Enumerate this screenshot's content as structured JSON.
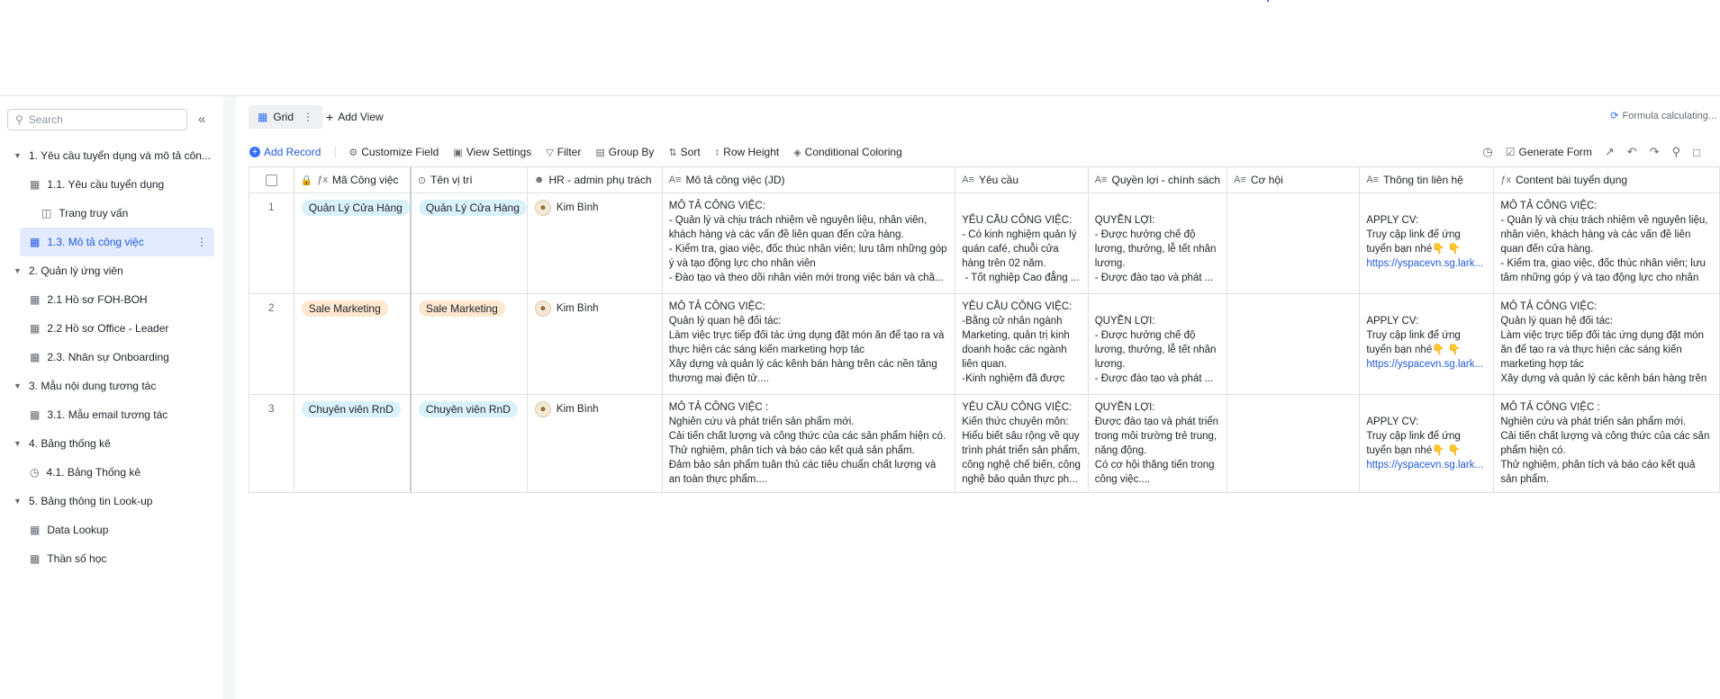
{
  "sidebar": {
    "search_placeholder": "Search",
    "items": [
      {
        "label": "1. Yêu cầu tuyển dụng và mô tả côn...",
        "level": 1
      },
      {
        "label": "1.1. Yêu cầu tuyển dụng",
        "level": 2,
        "icon": "table-icon"
      },
      {
        "label": "Trang truy vấn",
        "level": 3,
        "icon": "query-icon"
      },
      {
        "label": "1.3. Mô tả công việc",
        "level": 2,
        "icon": "table-icon",
        "selected": true
      },
      {
        "label": "2. Quản lý ứng viên",
        "level": 1
      },
      {
        "label": "2.1 Hồ sơ FOH-BOH",
        "level": 2,
        "icon": "table-icon"
      },
      {
        "label": "2.2 Hồ sơ Office - Leader",
        "level": 2,
        "icon": "table-icon"
      },
      {
        "label": "2.3. Nhân sự Onboarding",
        "level": 2,
        "icon": "table-icon"
      },
      {
        "label": "3. Mẫu nội dung tương tác",
        "level": 1
      },
      {
        "label": "3.1. Mẫu email tương tác",
        "level": 2,
        "icon": "table-icon"
      },
      {
        "label": "4. Bảng thống kê",
        "level": 1
      },
      {
        "label": "4.1. Bảng Thống kê",
        "level": 2,
        "icon": "dashboard-icon"
      },
      {
        "label": "5. Bảng thông tin Look-up",
        "level": 1
      },
      {
        "label": "Data Lookup",
        "level": 2,
        "icon": "table-icon"
      },
      {
        "label": "Thần số học",
        "level": 2,
        "icon": "table-icon"
      }
    ]
  },
  "tabs": {
    "grid": "Grid",
    "add_view": "Add View"
  },
  "status": "Formula calculating...",
  "toolbar": {
    "add_record": "Add Record",
    "customize_field": "Customize Field",
    "view_settings": "View Settings",
    "filter": "Filter",
    "group_by": "Group By",
    "sort": "Sort",
    "row_height": "Row Height",
    "conditional_coloring": "Conditional Coloring",
    "generate_form": "Generate Form"
  },
  "columns": [
    "Mã Công việc",
    "Tên vị trí",
    "HR - admin phụ trách",
    "Mô tả công việc (JD)",
    "Yêu cầu",
    "Quyền lợi - chính sách",
    "Cơ hội",
    "Thông tin liên hệ",
    "Content bài tuyển dụng"
  ],
  "rows": [
    {
      "num": "1",
      "code": "Quản Lý Cửa Hàng",
      "position": "Quản Lý Cửa Hàng",
      "hr": "Kim Bình",
      "jd": "MÔ TẢ CÔNG VIỆC:\n- Quản lý và chịu trách nhiệm về nguyên liệu, nhân viên, khách hàng và các vấn đề liên quan đến cửa hàng.\n- Kiểm tra, giao việc, đốc thúc nhân viên; lưu tâm những góp ý và tạo động lực cho nhân viên\n- Đào tạo và theo dõi nhân viên mới trong việc bán và chă...",
      "req": "\nYÊU CẦU CÔNG VIỆC:\n- Có kinh nghiệm quản lý quán café, chuỗi cửa hàng trên 02 năm.\n - Tốt nghiệp Cao đẳng ...",
      "benefit": "\nQUYỀN LỢI:\n- Được hưởng chế độ lương, thưởng, lễ tết nhân lương.\n- Được đào tạo và phát ...",
      "chance": "",
      "contact": "\nAPPLY CV:\nTruy cập link để ứng tuyển bạn nhé👇 👇\n",
      "link": "https://yspacevn.sg.lark...",
      "content": "MÔ TẢ CÔNG VIỆC:\n- Quản lý và chịu trách nhiệm về nguyên liệu, nhân viên, khách hàng và các vấn đề liên quan đến cửa hàng.\n- Kiểm tra, giao việc, đốc thúc nhân viên; lưu tâm những góp ý và tạo động lực cho nhân viên\n- Đào tạo và theo dõi nhân viên mới trong việc bán và chă..."
    },
    {
      "num": "2",
      "code": "Sale Marketing",
      "position": "Sale Marketing",
      "hr": "Kim Bình",
      "jd": "MÔ TẢ CÔNG VIỆC:\nQuản lý quan hệ đối tác:\nLàm việc trực tiếp đối tác ứng dụng đặt món ăn để tạo ra và thực hiện các sáng kiến marketing hợp tác\nXây dựng và quản lý các kênh bán hàng trên các nền tảng thương mại điện tử....",
      "req": "YÊU CẦU CÔNG VIỆC:\n-Bằng cử nhân ngành Marketing, quản trị kinh doanh hoặc các ngành liên quan.\n-Kinh nghiệm đã được c...",
      "benefit": "\nQUYỀN LỢI:\n- Được hưởng chế độ lương, thưởng, lễ tết nhân lương.\n- Được đào tạo và phát ...",
      "chance": "",
      "contact": "\nAPPLY CV:\nTruy cập link để ứng tuyển bạn nhé👇 👇\n",
      "link": "https://yspacevn.sg.lark...",
      "content": "MÔ TẢ CÔNG VIỆC:\nQuản lý quan hệ đối tác:\nLàm việc trực tiếp đối tác ứng dụng đặt món ăn để tạo ra và thực hiện các sáng kiến marketing hợp tác\nXây dựng và quản lý các kênh bán hàng trên các nền tảng thương mại điện tử...."
    },
    {
      "num": "3",
      "code": "Chuyên viên RnD",
      "position": "Chuyên viên RnD",
      "hr": "Kim Bình",
      "jd": "MÔ TẢ CÔNG VIỆC :\nNghiên cứu và phát triển sản phẩm mới.\nCải tiến chất lượng và công thức của các sản phẩm hiện có.\nThử nghiệm, phân tích và báo cáo kết quả sản phẩm.\nĐảm bảo sản phẩm tuân thủ các tiêu chuẩn chất lượng và an toàn thực phẩm....",
      "req": "YÊU CẦU CÔNG VIỆC:\nKiến thức chuyên môn: Hiểu biết sâu rộng về quy trình phát triển sản phẩm, công nghệ chế biến, công nghệ bảo quản thực ph...",
      "benefit": "QUYỀN LỢI:\nĐược đào tạo và phát triển trong môi trường trẻ trung, năng động.\nCó cơ hội thăng tiến trong công việc....",
      "chance": "",
      "contact": "\nAPPLY CV:\nTruy cập link để ứng tuyển bạn nhé👇 👇\n",
      "link": "https://yspacevn.sg.lark...",
      "content": "MÔ TẢ CÔNG VIỆC :\nNghiên cứu và phát triển sản phẩm mới.\nCải tiến chất lượng và công thức của các sản phẩm hiện có.\nThử nghiệm, phân tích và báo cáo kết quả sản phẩm.\nĐảm bảo sản phẩm tuân thủ các tiêu chuẩn chất lượng và an toàn thực phẩm...."
    }
  ],
  "colors": {
    "accent": "#3370ff",
    "tag_blue": "#d9f1fb",
    "tag_orange": "#fde7cf"
  }
}
